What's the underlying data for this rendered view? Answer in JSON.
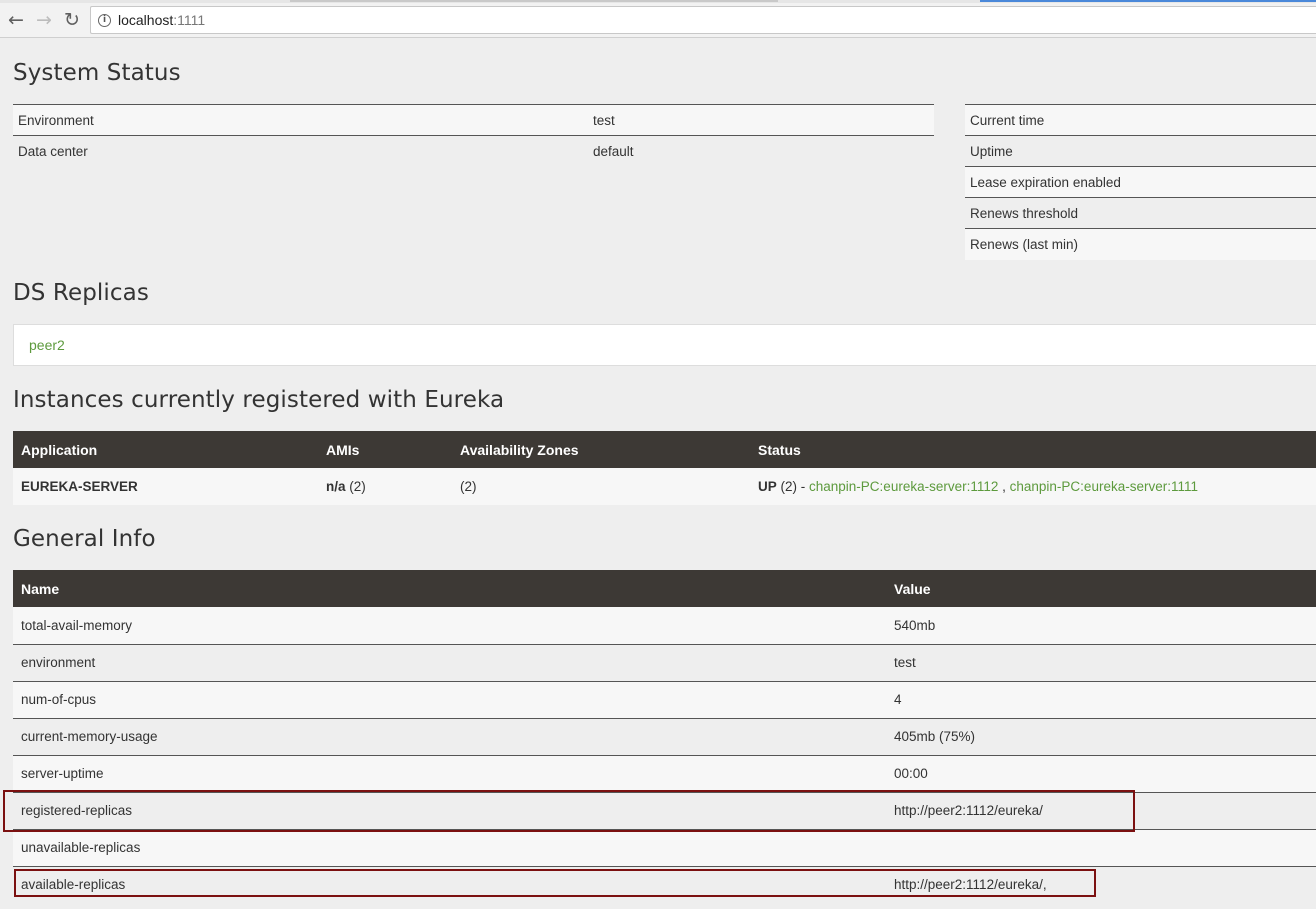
{
  "browser": {
    "url_host": "localhost",
    "url_port": ":1111",
    "back_icon": "arrow-left-icon",
    "forward_icon": "arrow-right-icon",
    "reload_icon": "reload-icon",
    "info_icon": "info-icon"
  },
  "system_status": {
    "title": "System Status",
    "left": [
      {
        "label": "Environment",
        "value": "test"
      },
      {
        "label": "Data center",
        "value": "default"
      }
    ],
    "right": [
      {
        "label": "Current time"
      },
      {
        "label": "Uptime"
      },
      {
        "label": "Lease expiration enabled"
      },
      {
        "label": "Renews threshold"
      },
      {
        "label": "Renews (last min)"
      }
    ]
  },
  "ds_replicas": {
    "title": "DS Replicas",
    "items": [
      "peer2"
    ]
  },
  "instances": {
    "title": "Instances currently registered with Eureka",
    "headers": [
      "Application",
      "AMIs",
      "Availability Zones",
      "Status"
    ],
    "rows": [
      {
        "application": "EUREKA-SERVER",
        "amis_bold": "n/a",
        "amis_count": " (2)",
        "zones": "(2)",
        "status_bold": "UP",
        "status_count": " (2) - ",
        "link1": "chanpin-PC:eureka-server:1112",
        "sep": " , ",
        "link2": "chanpin-PC:eureka-server:1111"
      }
    ]
  },
  "general_info": {
    "title": "General Info",
    "headers": [
      "Name",
      "Value"
    ],
    "rows": [
      {
        "name": "total-avail-memory",
        "value": "540mb"
      },
      {
        "name": "environment",
        "value": "test"
      },
      {
        "name": "num-of-cpus",
        "value": "4"
      },
      {
        "name": "current-memory-usage",
        "value": "405mb (75%)"
      },
      {
        "name": "server-uptime",
        "value": "00:00"
      },
      {
        "name": "registered-replicas",
        "value": "http://peer2:1112/eureka/"
      },
      {
        "name": "unavailable-replicas",
        "value": ""
      },
      {
        "name": "available-replicas",
        "value": "http://peer2:1112/eureka/,"
      }
    ]
  },
  "colors": {
    "header_bg": "#3d3935",
    "link": "#5d9a3d",
    "highlight": "#7b1010"
  }
}
